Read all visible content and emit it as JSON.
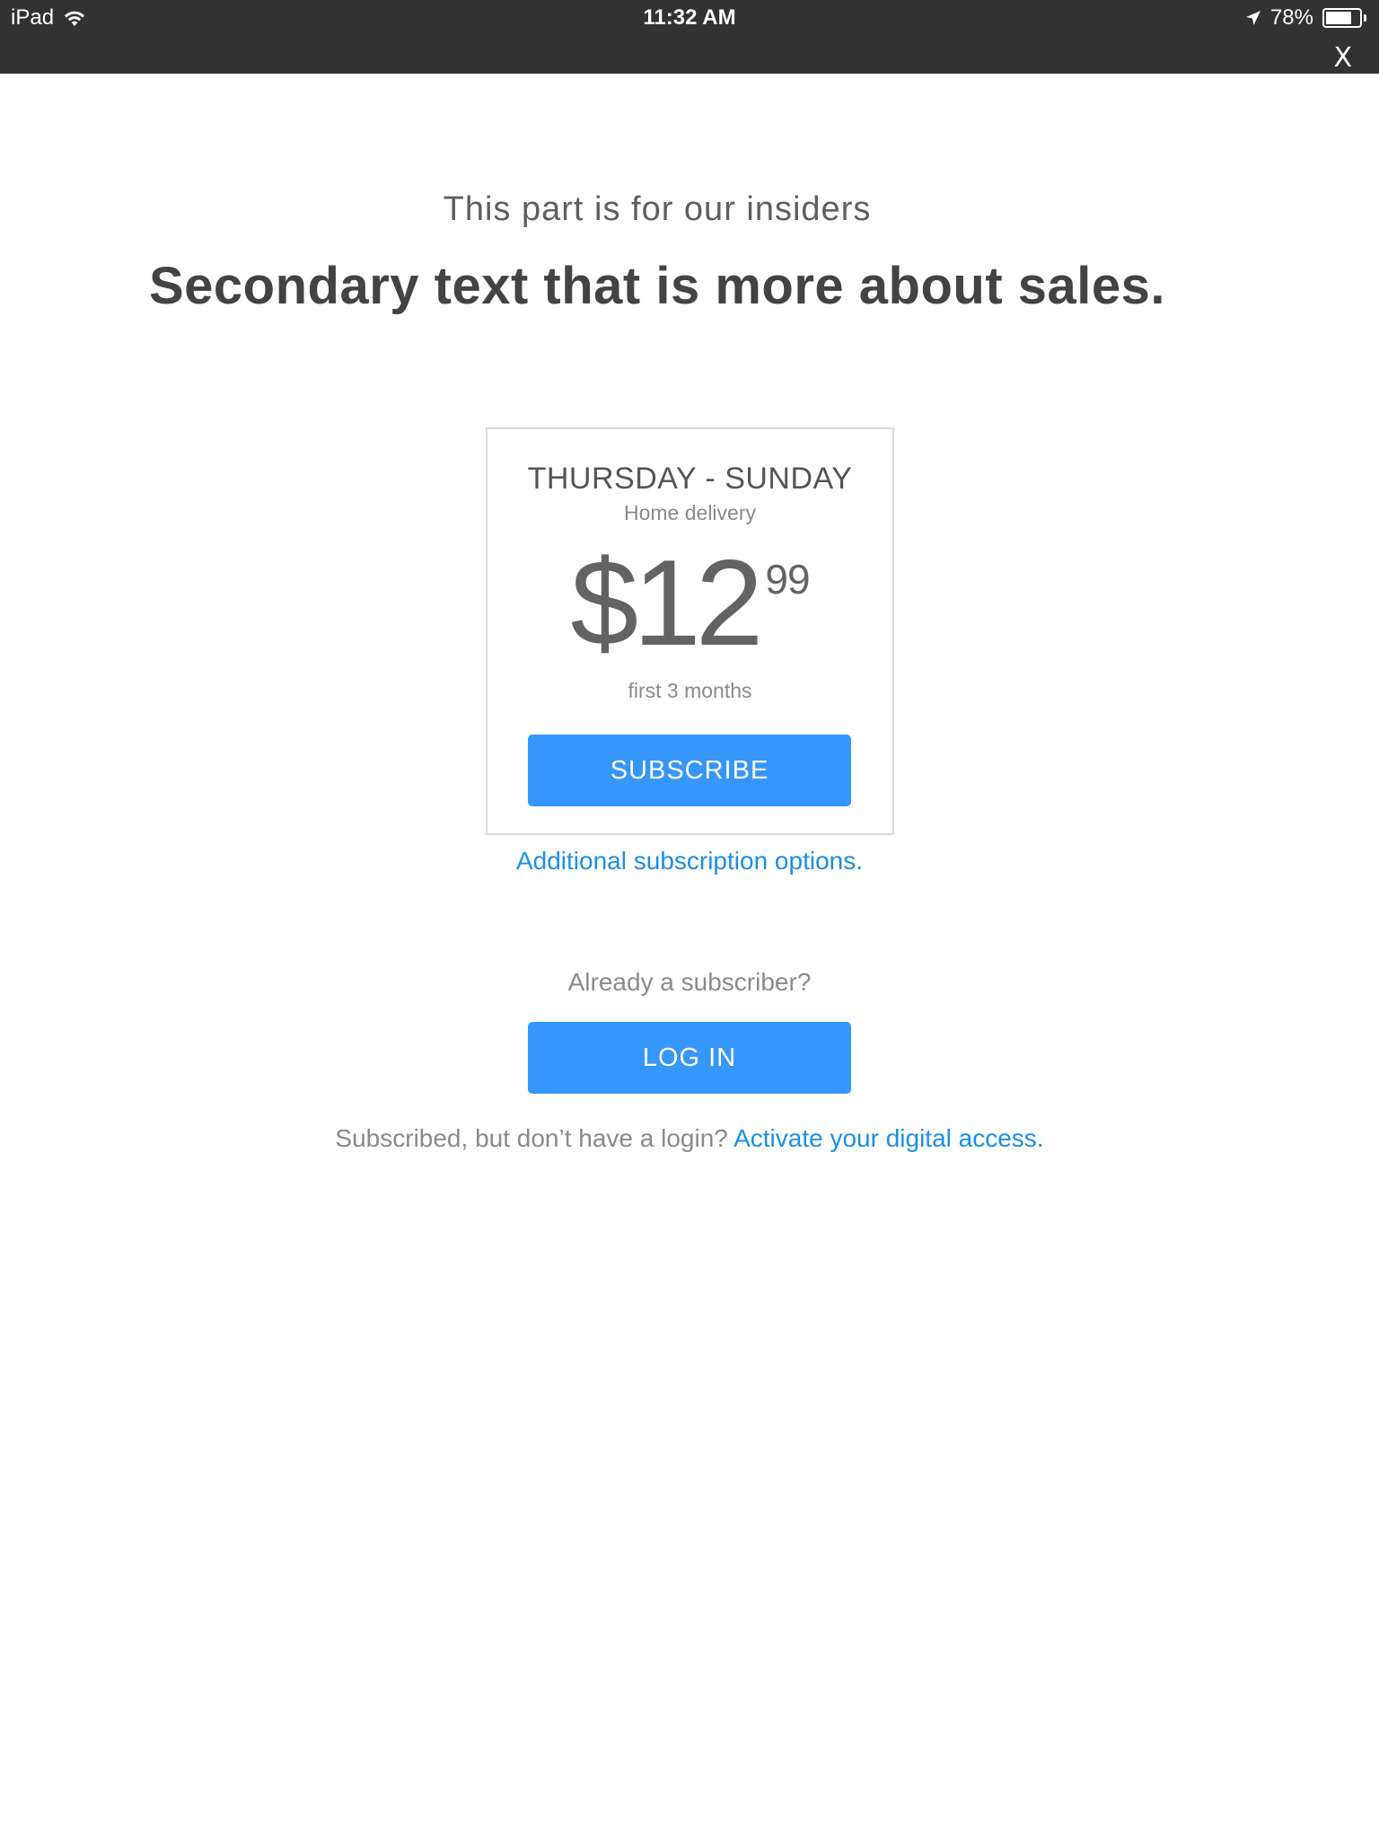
{
  "status_bar": {
    "device": "iPad",
    "time": "11:32 AM",
    "battery": "78%",
    "battery_level": 0.78
  },
  "close_label": "X",
  "eyebrow": "This part is for our insiders",
  "headline": "Secondary text that is more about sales.",
  "offer": {
    "title": "THURSDAY - SUNDAY",
    "subtitle": "Home delivery",
    "price_main": "$12",
    "price_cents": "99",
    "term": "first 3 months",
    "button_label": "SUBSCRIBE"
  },
  "additional_options_link": "Additional subscription options.",
  "login": {
    "prompt": "Already a subscriber?",
    "button_label": "LOG IN",
    "activate_text": "Subscribed, but don’t have a login?",
    "activate_link": "Activate your digital access."
  },
  "colors": {
    "status_bar_bg": "#323232",
    "button_blue": "#3796fa",
    "link_blue": "#1b8fe6"
  },
  "icons": [
    "wifi-icon",
    "location-arrow-icon",
    "battery-icon",
    "close-icon"
  ]
}
